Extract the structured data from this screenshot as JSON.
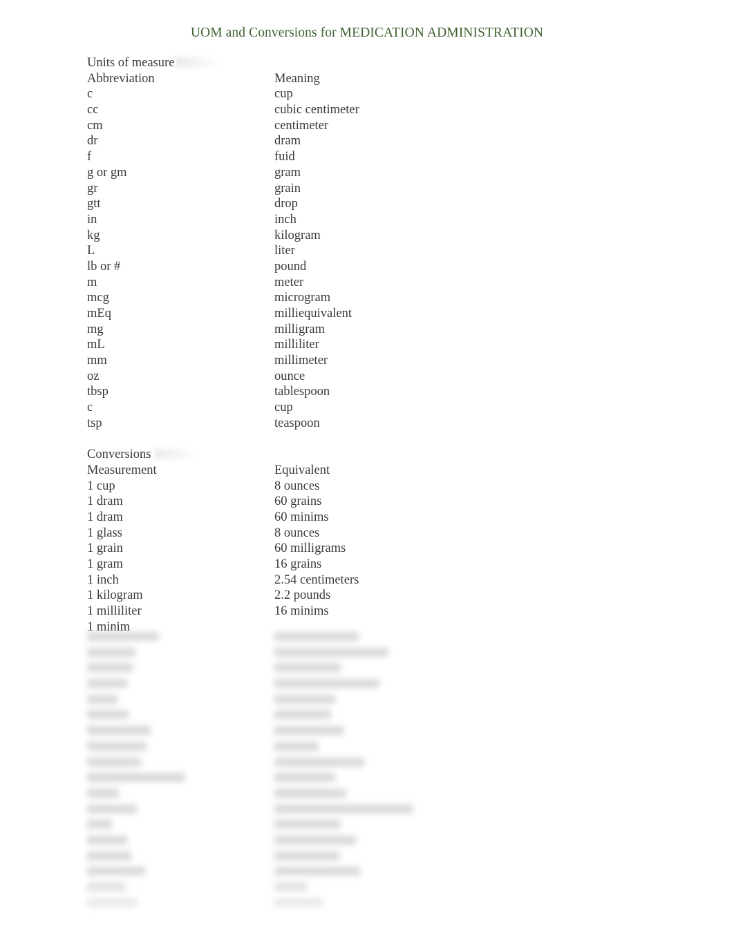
{
  "document": {
    "title": "UOM and Conversions for MEDICATION ADMINISTRATION",
    "title_color": "#3f6130",
    "body_color": "#3a3a3a",
    "background_color": "#ffffff"
  },
  "units_section": {
    "heading": "Units of measure",
    "col_header_left": "Abbreviation",
    "col_header_right": "Meaning",
    "rows": [
      {
        "abbreviation": "c",
        "meaning": "cup"
      },
      {
        "abbreviation": "cc",
        "meaning": "cubic centimeter"
      },
      {
        "abbreviation": "cm",
        "meaning": "centimeter"
      },
      {
        "abbreviation": "dr",
        "meaning": "dram"
      },
      {
        "abbreviation": "f",
        "meaning": "fuid"
      },
      {
        "abbreviation": "g or gm",
        "meaning": "gram"
      },
      {
        "abbreviation": "gr",
        "meaning": "grain"
      },
      {
        "abbreviation": "gtt",
        "meaning": "drop"
      },
      {
        "abbreviation": "in",
        "meaning": "inch"
      },
      {
        "abbreviation": "kg",
        "meaning": "kilogram"
      },
      {
        "abbreviation": "L",
        "meaning": "liter"
      },
      {
        "abbreviation": "lb or #",
        "meaning": "pound"
      },
      {
        "abbreviation": "m",
        "meaning": "meter"
      },
      {
        "abbreviation": "mcg",
        "meaning": "microgram"
      },
      {
        "abbreviation": "mEq",
        "meaning": "milliequivalent"
      },
      {
        "abbreviation": "mg",
        "meaning": "milligram"
      },
      {
        "abbreviation": "mL",
        "meaning": "milliliter"
      },
      {
        "abbreviation": "mm",
        "meaning": "millimeter"
      },
      {
        "abbreviation": "oz",
        "meaning": "ounce"
      },
      {
        "abbreviation": "tbsp",
        "meaning": "tablespoon"
      },
      {
        "abbreviation": "c",
        "meaning": "cup"
      },
      {
        "abbreviation": "tsp",
        "meaning": "teaspoon"
      }
    ]
  },
  "conversions_section": {
    "heading": "Conversions",
    "col_header_left": "Measurement",
    "col_header_right": "Equivalent",
    "rows": [
      {
        "measurement": "1 cup",
        "equivalent": "8 ounces"
      },
      {
        "measurement": "1 dram",
        "equivalent": "60 grains"
      },
      {
        "measurement": "1 dram",
        "equivalent": "60 minims"
      },
      {
        "measurement": "1 glass",
        "equivalent": "8 ounces"
      },
      {
        "measurement": "1 grain",
        "equivalent": "60 milligrams"
      },
      {
        "measurement": "1 gram",
        "equivalent": "16 grains"
      },
      {
        "measurement": "1 inch",
        "equivalent": "2.54 centimeters"
      },
      {
        "measurement": "1 kilogram",
        "equivalent": "2.2 pounds"
      },
      {
        "measurement": "1 milliliter",
        "equivalent": "16 minims"
      },
      {
        "measurement": "1 minim",
        "equivalent": ""
      }
    ]
  },
  "obscured_region": {
    "note": "Remaining document content is blurred and illegible in the screenshot.",
    "rows": [
      {
        "left_width": 104,
        "right_width": 122
      },
      {
        "left_width": 70,
        "right_width": 165
      },
      {
        "left_width": 66,
        "right_width": 96
      },
      {
        "left_width": 58,
        "right_width": 152
      },
      {
        "left_width": 44,
        "right_width": 88
      },
      {
        "left_width": 60,
        "right_width": 82
      },
      {
        "left_width": 92,
        "right_width": 100
      },
      {
        "left_width": 86,
        "right_width": 64
      },
      {
        "left_width": 78,
        "right_width": 130
      },
      {
        "left_width": 142,
        "right_width": 88
      },
      {
        "left_width": 46,
        "right_width": 104
      },
      {
        "left_width": 72,
        "right_width": 200
      },
      {
        "left_width": 36,
        "right_width": 96
      },
      {
        "left_width": 58,
        "right_width": 118
      },
      {
        "left_width": 64,
        "right_width": 94
      },
      {
        "left_width": 84,
        "right_width": 124
      },
      {
        "left_width": 56,
        "right_width": 48
      },
      {
        "left_width": 72,
        "right_width": 70
      }
    ]
  }
}
